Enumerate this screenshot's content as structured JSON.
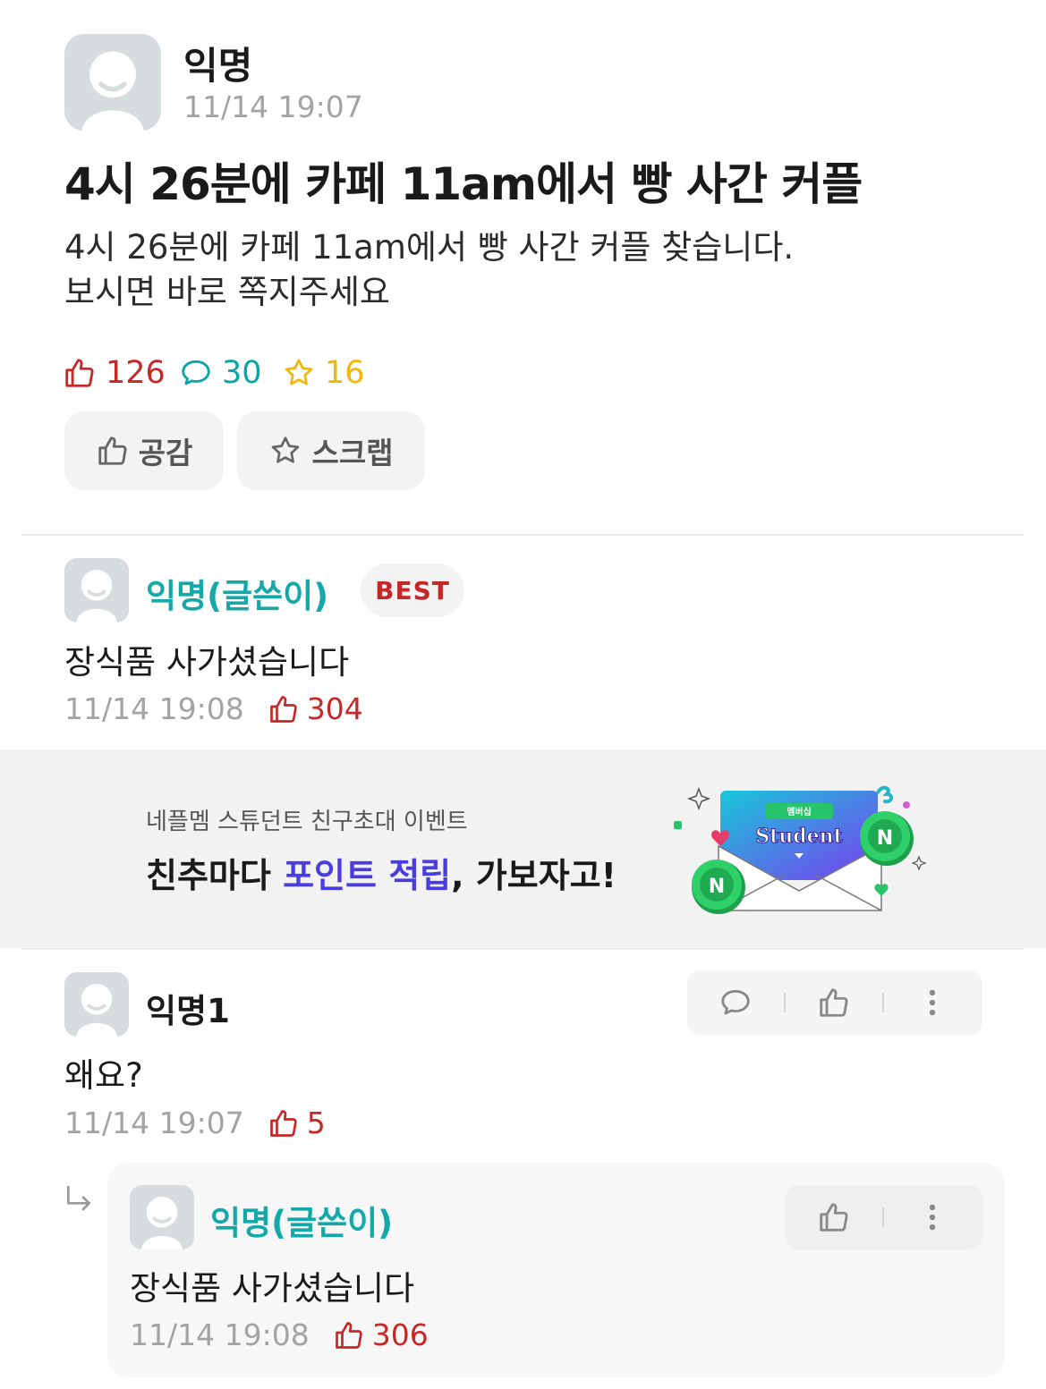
{
  "post": {
    "author": "익명",
    "time": "11/14 19:07",
    "title": "4시 26분에 카페 11am에서 빵 사간 커플",
    "body_lines": [
      "4시 26분에 카페 11am에서 빵 사간 커플 찾습니다.",
      "보시면 바로 쪽지주세요"
    ],
    "stats": {
      "likes": "126",
      "comments": "30",
      "scraps": "16"
    },
    "actions": {
      "like_label": "공감",
      "scrap_label": "스크랩"
    }
  },
  "best_comment": {
    "author": "익명(글쓴이)",
    "badge": "BEST",
    "text": "장식품 사가셨습니다",
    "time": "11/14 19:08",
    "likes": "304"
  },
  "ad": {
    "subtitle": "네플멤 스튜던트 친구초대 이벤트",
    "headline_pre": "친추마다 ",
    "headline_highlight": "포인트 적립",
    "headline_post": ", 가보자고!",
    "art_label": "Student",
    "art_badge": "멤버십"
  },
  "comments": [
    {
      "author": "익명1",
      "text": "왜요?",
      "time": "11/14 19:07",
      "likes": "5"
    }
  ],
  "reply": {
    "author": "익명(글쓴이)",
    "text": "장식품 사가셨습니다",
    "time": "11/14 19:08",
    "likes": "306"
  },
  "colors": {
    "like": "#c62828",
    "comment": "#0aa5a5",
    "scrap": "#f2b705",
    "op_name": "#14a8a8",
    "ad_highlight": "#4a3ddf"
  },
  "icons": [
    "avatar-icon",
    "thumb-up-icon",
    "speech-bubble-icon",
    "star-icon",
    "more-icon",
    "reply-arrow-icon"
  ]
}
